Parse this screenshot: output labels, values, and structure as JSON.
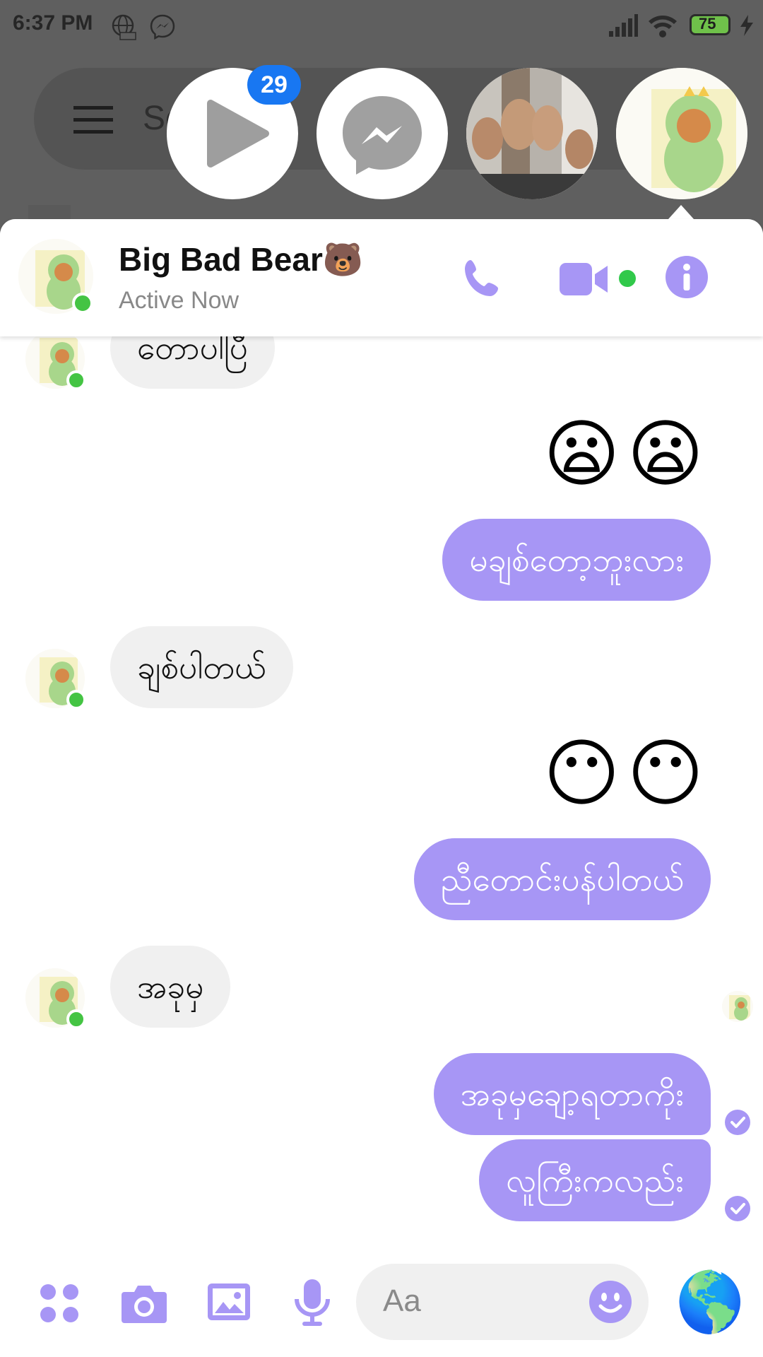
{
  "status_bar": {
    "time": "6:37 PM",
    "battery": "75"
  },
  "background": {
    "search_placeholder": "Se      m"
  },
  "chat_heads": {
    "unread_badge": "29"
  },
  "header": {
    "name": "Big Bad Bear🐻",
    "status": "Active Now"
  },
  "messages": [
    {
      "from": "them",
      "text": "တောပါပြီ"
    },
    {
      "from": "me",
      "emoji": "😦😦"
    },
    {
      "from": "me",
      "text": "မချစ်တော့ဘူးလား"
    },
    {
      "from": "them",
      "text": "ချစ်ပါတယ်"
    },
    {
      "from": "me",
      "emoji": "😶😶"
    },
    {
      "from": "me",
      "text": "ညီတောင်းပန်ပါတယ်"
    },
    {
      "from": "them",
      "text": "အခုမှ"
    },
    {
      "from": "me",
      "text": "အခုမှချော့ရတာကိုး"
    },
    {
      "from": "me",
      "text": "လူကြီးကလည်း"
    }
  ],
  "composer": {
    "placeholder": "Aa",
    "globe": "🌎"
  },
  "colors": {
    "accent": "#a796f5",
    "online": "#44c443",
    "badge": "#1877f2",
    "incoming_bubble": "#f0f0f0"
  }
}
